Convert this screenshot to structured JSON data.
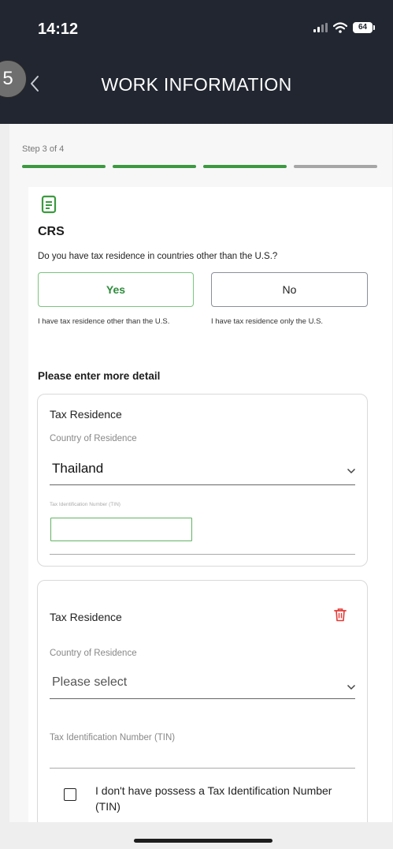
{
  "status_bar": {
    "time": "14:12",
    "battery": "64"
  },
  "header": {
    "title": "WORK INFORMATION"
  },
  "step": {
    "label": "Step 3 of 4",
    "badge": "5",
    "current": 3,
    "total": 4
  },
  "colors": {
    "accent": "#3b9a3f",
    "inactive": "#a6a6a6",
    "header_bg": "#212630",
    "delete": "#e53935"
  },
  "crs": {
    "title": "CRS",
    "question": "Do you have tax residence in countries other than the U.S.?",
    "yes_label": "Yes",
    "no_label": "No",
    "yes_hint": "I have tax residence other than the U.S.",
    "no_hint": "I have tax residence only the U.S.",
    "selected": "Yes"
  },
  "details": {
    "heading": "Please enter more detail",
    "residences": [
      {
        "title": "Tax Residence",
        "country_label": "Country of Residence",
        "country_value": "Thailand",
        "tin_label": "Tax Identification Number (TIN)",
        "tin_value": ""
      },
      {
        "title": "Tax Residence",
        "country_label": "Country of Residence",
        "country_placeholder": "Please select",
        "tin_label": "Tax Identification Number (TIN)",
        "no_tin_label": "I don't have possess a Tax Identification Number (TIN)"
      }
    ]
  },
  "icons": {
    "back": "chevron-left-icon",
    "document": "document-icon",
    "dropdown": "chevron-down-icon",
    "delete": "trash-icon",
    "signal": "signal-icon",
    "wifi": "wifi-icon",
    "battery": "battery-icon"
  }
}
